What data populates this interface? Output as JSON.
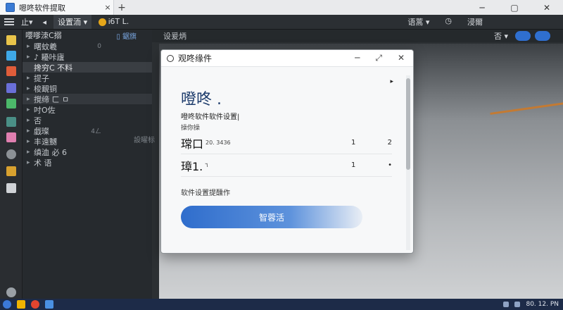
{
  "window": {
    "tab_title": "嗯咚软件提取",
    "tab_close": "×",
    "tab_new": "+",
    "minimize": "─",
    "maximize": "▢",
    "close": "✕"
  },
  "toolbar": {
    "item1": "止▾",
    "item2": "◂",
    "settings_label": "设置洏",
    "dropdown": "▾",
    "status": "Ꭵ6ꓔ L.",
    "right1": "语蒿 ▾",
    "right2": "◷",
    "right3": "浸爾"
  },
  "sidebar": {
    "header": "嘤嗲洓C搦",
    "open_label": "▯ 鋸旗",
    "items": [
      {
        "label": "曙蚊羲",
        "count": "0"
      },
      {
        "label": "♪ 耰咔廬",
        "count": ""
      },
      {
        "label": "搀穷C 不料",
        "count": ""
      },
      {
        "label": "提子",
        "count": ""
      },
      {
        "label": "梭靦铜",
        "count": ""
      },
      {
        "label": "撹缔 ㄈ ㅁ",
        "count": ""
      },
      {
        "label": "吋O佐",
        "count": ""
      },
      {
        "label": "否",
        "count": ""
      },
      {
        "label": "戯璨",
        "count": "4ㄥ"
      },
      {
        "label": "丰遠嬲",
        "count": ""
      },
      {
        "label": "缜洫 必 6",
        "count": ""
      },
      {
        "label": "术 语",
        "count": ""
      }
    ]
  },
  "editor": {
    "tab_label": "设爰炳",
    "side_hint": "設曜标",
    "right_label": "否 ▾"
  },
  "dialog": {
    "title": "观咚缘件",
    "heading": "噔咚 .",
    "subtitle": "噔咚软件软件设置|",
    "subtitle2": "操你操",
    "row1_key": "瑺口",
    "row1_sub": "20. 3436",
    "row1_v1": "1",
    "row1_v2": "2",
    "row2_key": "璋1.",
    "row2_sub": "٦",
    "row2_v1": "1",
    "row2_v2": "•",
    "note": "软件设置提醺作",
    "primary_button": "智蓉活",
    "minimize": "─",
    "expand": "⤢",
    "close": "✕",
    "cursor": "▸"
  },
  "taskbar": {
    "clock": "80. 12. PN"
  }
}
